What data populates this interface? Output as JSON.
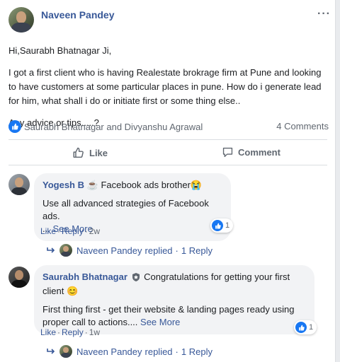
{
  "post": {
    "author": "Naveen Pandey",
    "more_label": "···",
    "paragraphs": [
      "Hi,Saurabh Bhatnagar Ji,",
      "I got a first client who is having Realestate brokrage firm at Pune and looking to have customers at some particular places in pune. How do i generate lead for him, what shall i do or initiate first or some thing else..",
      "Any advice or tips.....?"
    ],
    "reactors": "Saurabh Bhatnagar and Divyanshu Agrawal",
    "comments_count": "4 Comments",
    "like_label": "Like",
    "comment_label": "Comment"
  },
  "comments": [
    {
      "author": "Yogesh B",
      "author_badge_emoji": "☕",
      "text_after_name": "Facebook ads brother😭",
      "body": "Use all advanced strategies of Facebook ads.",
      "ellipsis": "...",
      "see_more": "See More",
      "like": "Like",
      "reply": "Reply",
      "time": "2w",
      "reaction_count": "1",
      "replies_summary": {
        "name": "Naveen Pandey",
        "replied": "replied",
        "count": "1 Reply"
      }
    },
    {
      "author": "Saurabh Bhatnagar",
      "text_after_name": "Congratulations for getting your first client 😊",
      "body": "First thing first - get their website & landing pages ready using proper call to actions....",
      "see_more": "See More",
      "like": "Like",
      "reply": "Reply",
      "time": "1w",
      "reaction_count": "1",
      "replies_summary": {
        "name": "Naveen Pandey",
        "replied": "replied",
        "count": "1 Reply"
      }
    }
  ],
  "separators": {
    "dot": "·"
  },
  "colors": {
    "link": "#385898",
    "like_blue": "#1877f2",
    "bubble": "#f2f3f5",
    "muted": "#606770"
  }
}
